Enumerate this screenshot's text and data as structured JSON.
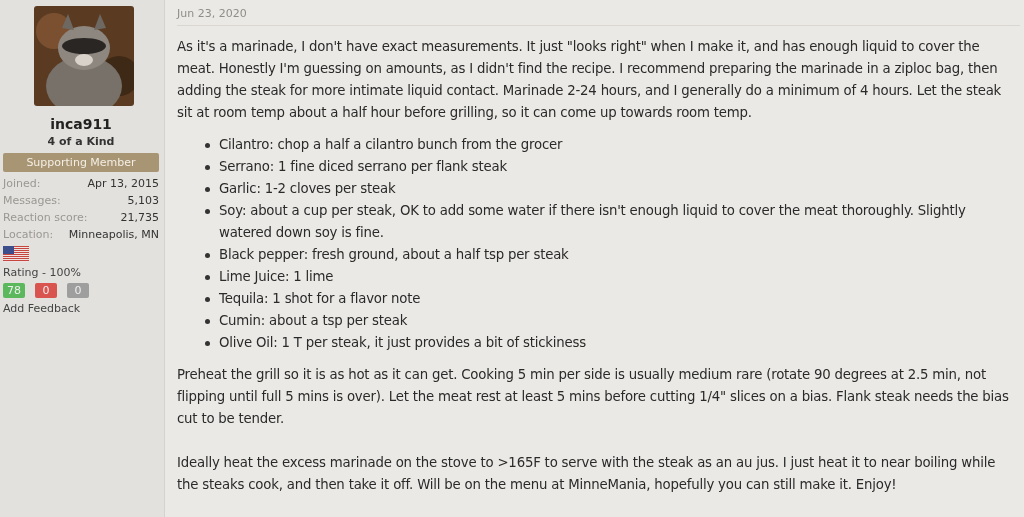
{
  "user": {
    "name": "inca911",
    "title": "4 of a Kind",
    "banner": "Supporting Member",
    "stats": [
      {
        "label": "Joined:",
        "value": "Apr 13, 2015"
      },
      {
        "label": "Messages:",
        "value": "5,103"
      },
      {
        "label": "Reaction score:",
        "value": "21,735"
      },
      {
        "label": "Location:",
        "value": "Minneapolis, MN"
      }
    ],
    "rating": "Rating - 100%",
    "feedback": [
      {
        "count": "78",
        "color": "#5cb85c"
      },
      {
        "count": "0",
        "color": "#d9534f"
      },
      {
        "count": "0",
        "color": "#9e9e9e"
      }
    ],
    "add_feedback": "Add Feedback"
  },
  "post": {
    "date": "Jun 23, 2020",
    "intro": "As it's a marinade, I don't have exact measurements. It just \"looks right\" when I make it, and has enough liquid to cover the meat. Honestly I'm guessing on amounts, as I didn't find the recipe. I recommend preparing the marinade in a ziploc bag, then adding the steak for more intimate liquid contact. Marinade 2-24 hours, and I generally do a minimum of 4 hours. Let the steak sit at room temp about a half hour before grilling, so it can come up towards room temp.",
    "ingredients": [
      "Cilantro: chop a half a cilantro bunch from the grocer",
      "Serrano: 1 fine diced serrano per flank steak",
      "Garlic: 1-2 cloves per steak",
      "Soy: about a cup per steak, OK to add some water if there isn't enough liquid to cover the meat thoroughly. Slightly watered down soy is fine.",
      "Black pepper: fresh ground, about a half tsp per steak",
      "Lime Juice: 1 lime",
      "Tequila: 1 shot for a flavor note",
      "Cumin: about a tsp per steak",
      "Olive Oil: 1 T per steak, it just provides a bit of stickiness"
    ],
    "paragraphs": [
      "Preheat the grill so it is as hot as it can get. Cooking 5 min per side is usually medium rare (rotate 90 degrees at 2.5 min, not flipping until full 5 mins is over). Let the meat rest at least 5 mins before cutting 1/4\" slices on a bias. Flank steak needs the bias cut to be tender.",
      "Ideally heat the excess marinade on the stove to >165F to serve with the steak as an au jus. I just heat it to near boiling while the steaks cook, and then take it off. Will be on the menu at MinneMania, hopefully you can still make it. Enjoy!"
    ]
  }
}
